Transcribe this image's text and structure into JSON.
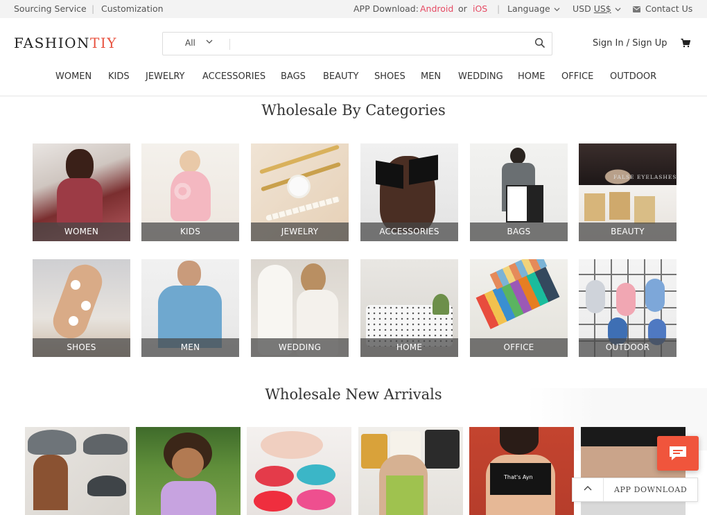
{
  "topbar": {
    "sourcing": "Sourcing Service",
    "divider": "|",
    "customization": "Customization",
    "app_download": "APP Download:",
    "android": "Android",
    "or": "or",
    "ios": "iOS",
    "language": "Language",
    "currency_prefix": "USD",
    "currency": "US$",
    "contact": "Contact Us"
  },
  "header": {
    "logo_main": "FASHION",
    "logo_accent": "TIY",
    "search_category": "All",
    "search_placeholder": "",
    "sign_in": "Sign In",
    "slash": "/",
    "sign_up": "Sign Up"
  },
  "nav": [
    "WOMEN",
    "KIDS",
    "JEWELRY",
    "ACCESSORIES",
    "BAGS",
    "BEAUTY",
    "SHOES",
    "MEN",
    "WEDDING",
    "HOME",
    "OFFICE",
    "OUTDOOR"
  ],
  "categories_title": "Wholesale By Categories",
  "categories": [
    "WOMEN",
    "KIDS",
    "JEWELRY",
    "ACCESSORIES",
    "BAGS",
    "BEAUTY",
    "SHOES",
    "MEN",
    "WEDDING",
    "HOME",
    "OFFICE",
    "OUTDOOR"
  ],
  "beauty_overlay_text": "FALSE EYELASHES",
  "arrivals_title": "Wholesale New Arrivals",
  "arrival_shirt_text": "That's Ayn",
  "floating": {
    "app_download": "APP DOWNLOAD"
  },
  "colors": {
    "accent_pink": "#e64a63",
    "logo_accent": "#e8523f",
    "chat_button": "#f0553c"
  },
  "icons": [
    "chevron-down-icon",
    "search-icon",
    "cart-icon",
    "mail-icon",
    "chat-icon",
    "arrow-up-icon"
  ]
}
